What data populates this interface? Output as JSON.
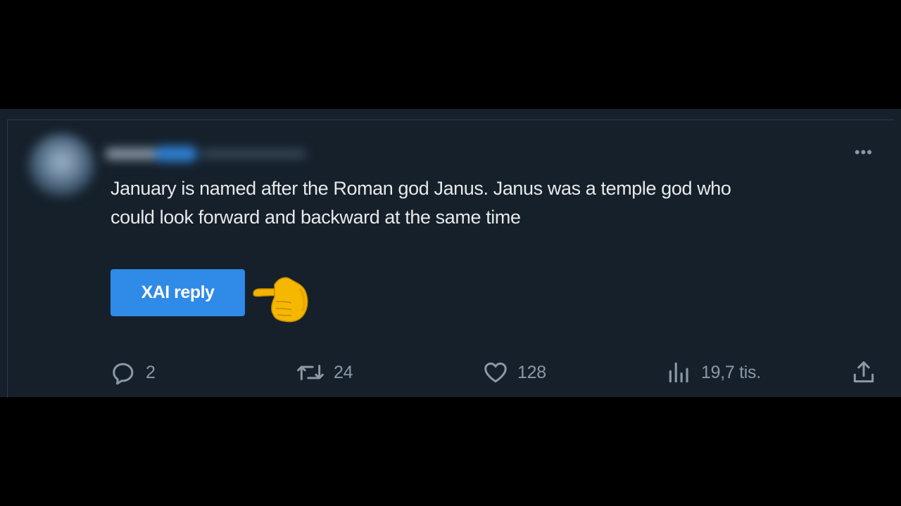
{
  "tweet": {
    "text_line1": "January is named after the Roman god Janus. Janus was a temple god who",
    "text_line2": "could look forward and backward at the same time",
    "button_label": "XAI reply",
    "pointer_icon": "backhand-index-pointing-left-emoji"
  },
  "actions": {
    "replies": "2",
    "retweets": "24",
    "likes": "128",
    "views": "19,7 tis."
  },
  "colors": {
    "background": "#15202b",
    "accent": "#2f8ae8",
    "text": "#e7e9ea",
    "muted": "#8b98a5"
  }
}
